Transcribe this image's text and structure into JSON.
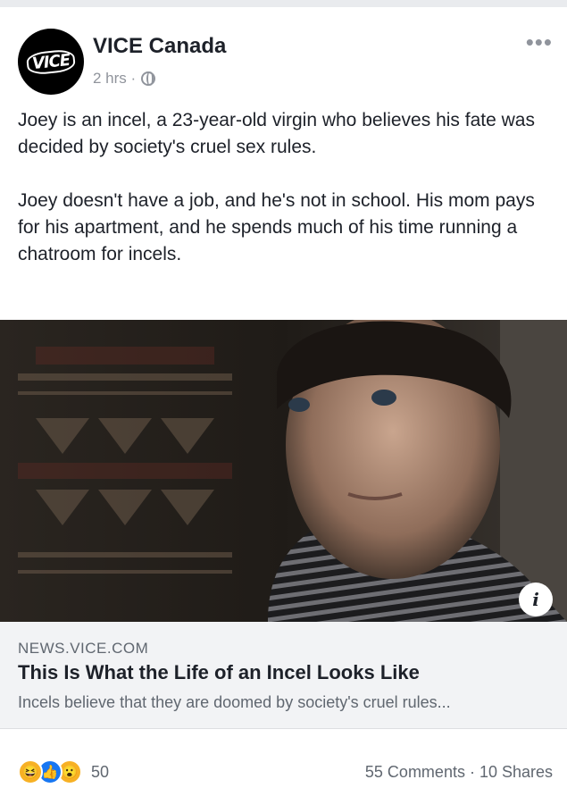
{
  "post": {
    "page_name": "VICE Canada",
    "avatar_text": "VICE",
    "time": "2 hrs ·",
    "privacy_icon": "globe-icon",
    "more_label": "•••",
    "paragraph1": "Joey is an incel, a 23-year-old virgin who believes his fate was decided by society's cruel sex rules.",
    "paragraph2": "Joey doesn't have a job, and he's not in school. His mom pays for his apartment, and he spends much of his time running a chatroom for incels."
  },
  "link": {
    "info_label": "i",
    "domain": "NEWS.VICE.COM",
    "title": "This Is What the Life of an Incel Looks Like",
    "description": "Incels believe that they are doomed by society's cruel rules..."
  },
  "footer": {
    "reactions": [
      "haha-icon",
      "like-icon",
      "wow-icon"
    ],
    "reaction_count": "50",
    "stats": "55 Comments · 10 Shares"
  },
  "colors": {
    "background": "#e9ebee",
    "card": "#ffffff",
    "link_box": "#f2f3f5",
    "secondary_text": "#90949c",
    "like_blue": "#1877f2",
    "haha_yellow": "#f7b125"
  }
}
